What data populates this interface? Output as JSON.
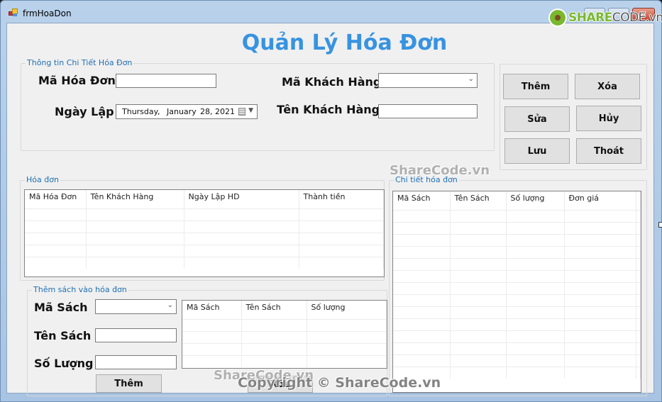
{
  "window": {
    "title": "frmHoaDon",
    "controls": {
      "minimize": "",
      "maximize": "",
      "close": "✕"
    }
  },
  "header": {
    "title": "Quản Lý Hóa Đơn"
  },
  "invoice_info": {
    "legend": "Thông tin Chi Tiết Hóa Đơn",
    "invoice_id_label": "Mã Hóa Đơn",
    "invoice_id_value": "",
    "date_label": "Ngày Lập",
    "date_value": {
      "weekday": "Thursday",
      "sep": ",",
      "month": "January",
      "day_year": "28, 2021"
    },
    "customer_id_label": "Mã Khách Hàng",
    "customer_id_value": "",
    "customer_name_label": "Tên Khách Hàng",
    "customer_name_value": ""
  },
  "actions": {
    "add": "Thêm",
    "delete": "Xóa",
    "edit": "Sửa",
    "cancel": "Hủy",
    "save": "Lưu",
    "exit": "Thoát"
  },
  "invoices": {
    "legend": "Hóa đơn",
    "columns": [
      "Mã Hóa Đơn",
      "Tên Khách Hàng",
      "Ngày Lập HD",
      "Thành tiền"
    ],
    "rows": []
  },
  "invoice_details": {
    "legend": "Chi tiết hóa đơn",
    "columns": [
      "Mã Sách",
      "Tên Sách",
      "Số lượng",
      "Đơn giá"
    ],
    "rows": []
  },
  "add_book": {
    "legend": "Thêm sách vào hóa đơn",
    "book_id_label": "Mã Sách",
    "book_id_value": "",
    "book_name_label": "Tên Sách",
    "book_name_value": "",
    "quantity_label": "Số Lượng",
    "quantity_value": "",
    "add_button": "Thêm",
    "delete_button": "Xóa",
    "columns": [
      "Mã Sách",
      "Tên Sách",
      "Số lượng"
    ],
    "rows": []
  },
  "watermarks": {
    "logo_share": "SHARE",
    "logo_code": "CODE.vn",
    "mid": "ShareCode.vn",
    "bottom_left": "ShareCode.vn",
    "copyright": "Copyright © ShareCode.vn"
  },
  "colors": {
    "title_blue": "#3793e0",
    "legend_blue": "#1f6fb3",
    "logo_green": "#7ab82f"
  }
}
